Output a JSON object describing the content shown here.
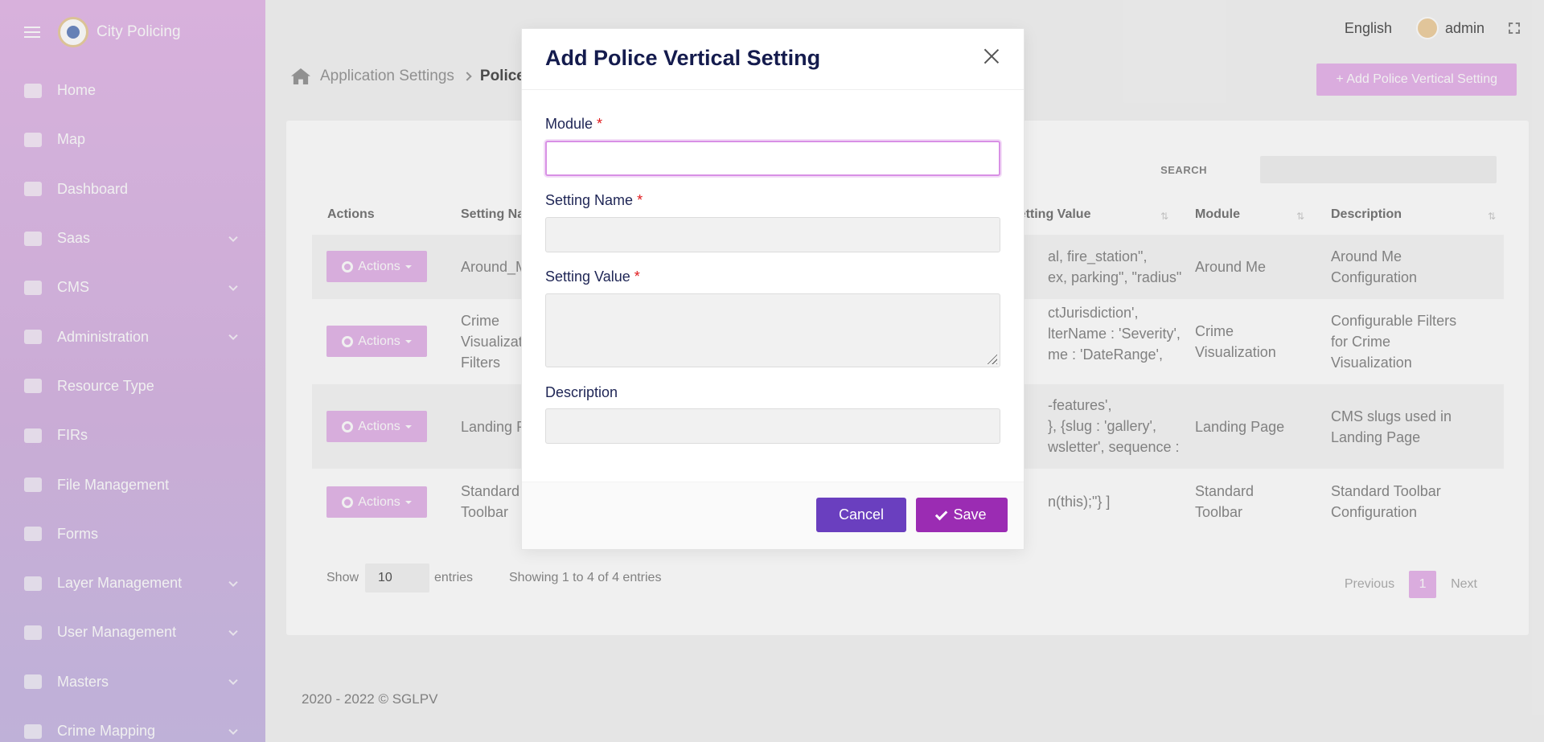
{
  "app": {
    "brand": "City Policing"
  },
  "sidebar": {
    "items": [
      {
        "label": "Home",
        "icon": "home-icon",
        "expandable": false
      },
      {
        "label": "Map",
        "icon": "map-icon",
        "expandable": false
      },
      {
        "label": "Dashboard",
        "icon": "chart-icon",
        "expandable": false
      },
      {
        "label": "Saas",
        "icon": "globe-icon",
        "expandable": true
      },
      {
        "label": "CMS",
        "icon": "id-card-icon",
        "expandable": true
      },
      {
        "label": "Administration",
        "icon": "wrench-icon",
        "expandable": true
      },
      {
        "label": "Resource Type",
        "icon": "file-icon",
        "expandable": false
      },
      {
        "label": "FIRs",
        "icon": "file-icon",
        "expandable": false
      },
      {
        "label": "File Management",
        "icon": "folder-icon",
        "expandable": false
      },
      {
        "label": "Forms",
        "icon": "list-icon",
        "expandable": false
      },
      {
        "label": "Layer Management",
        "icon": "layers-icon",
        "expandable": true
      },
      {
        "label": "User Management",
        "icon": "users-icon",
        "expandable": true
      },
      {
        "label": "Masters",
        "icon": "users-icon",
        "expandable": true
      },
      {
        "label": "Crime Mapping",
        "icon": "pin-icon",
        "expandable": true
      }
    ]
  },
  "topbar": {
    "language": "English",
    "username": "admin"
  },
  "breadcrumb": {
    "parent": "Application Settings",
    "current": "Police Vertical Setting"
  },
  "page": {
    "add_button": "+ Add Police Vertical Setting"
  },
  "table": {
    "search_label": "SEARCH",
    "headers": [
      "Actions",
      "Setting Name",
      "Setting Value",
      "Module",
      "Description"
    ],
    "action_label": "Actions",
    "rows": [
      {
        "name": "Around_Me",
        "value": "al, fire_station\",\nex, parking\", \"radius\"",
        "module": "Around Me",
        "description": "Around Me\nConfiguration"
      },
      {
        "name": "Crime\nVisualization\nFilters",
        "value": "ctJurisdiction',\nlterName : 'Severity',\nme : 'DateRange',",
        "module": "Crime\nVisualization",
        "description": "Configurable Filters\nfor Crime\nVisualization"
      },
      {
        "name": "Landing Page",
        "value": "-features',\n}, {slug : 'gallery',\nwsletter', sequence :",
        "module": "Landing Page",
        "description": "CMS slugs used in\nLanding Page"
      },
      {
        "name": "Standard\nToolbar",
        "value": "n(this);\"} ]",
        "module": "Standard\nToolbar",
        "description": "Standard Toolbar\nConfiguration"
      }
    ],
    "show_label": "Show",
    "entries_value": "10",
    "entries_label": "entries",
    "info": "Showing 1 to 4 of 4 entries",
    "pagination": {
      "previous": "Previous",
      "page": "1",
      "next": "Next"
    }
  },
  "footer": {
    "copyright": "2020 - 2022 © SGLPV"
  },
  "modal": {
    "title": "Add Police Vertical Setting",
    "fields": {
      "module": {
        "label": "Module",
        "value": ""
      },
      "setting_name": {
        "label": "Setting Name",
        "value": ""
      },
      "setting_value": {
        "label": "Setting Value",
        "value": ""
      },
      "description": {
        "label": "Description",
        "value": ""
      }
    },
    "required_mark": "*",
    "cancel": "Cancel",
    "save": "Save"
  },
  "colors": {
    "sidebar_gradient_start": "#e6bdea",
    "sidebar_gradient_end": "#cbbde6",
    "accent_pink": "#e8b7ec",
    "cancel_purple": "#6a3fbf",
    "save_magenta": "#9b2cb3",
    "title_navy": "#141b4d",
    "required_red": "#e0191c"
  }
}
